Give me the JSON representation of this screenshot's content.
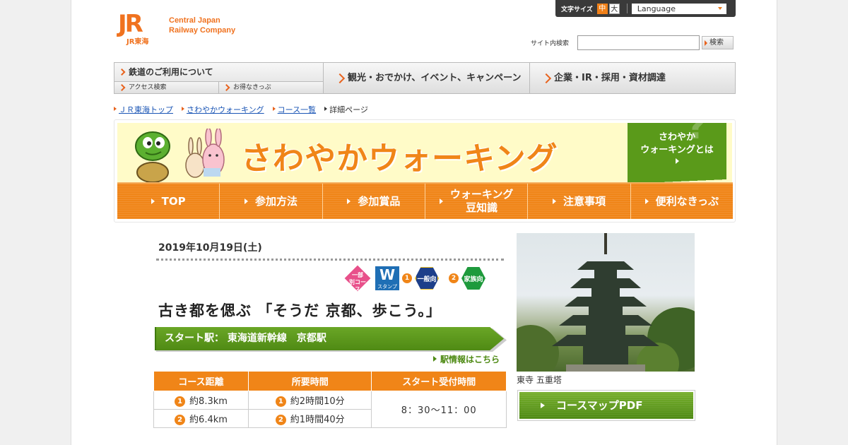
{
  "header": {
    "logo_mark": "JR",
    "logo_sub": "JR東海",
    "logo_line1": "Central Japan",
    "logo_line2": "Railway Company",
    "font_size_label": "文字サイズ",
    "font_size_mid": "中",
    "font_size_large": "大",
    "language_label": "Language",
    "search_label": "サイト内検索",
    "search_value": "",
    "search_button": "検索"
  },
  "gnav": {
    "railway": "鉄道のご利用について",
    "access": "アクセス検索",
    "tickets": "お得なきっぷ",
    "tourism": "観光・おでかけ、イベント、キャンペーン",
    "corporate": "企業・IR・採用・資材調達"
  },
  "breadcrumb": [
    "ＪＲ東海トップ",
    "さわやかウォーキング",
    "コース一覧",
    "詳細ページ"
  ],
  "banner": {
    "title": "さわやかウォーキング",
    "about_line1": "さわやか",
    "about_line2": "ウォーキングとは",
    "nav": [
      "TOP",
      "参加方法",
      "参加賞品",
      "ウォーキング\n豆知識",
      "注意事項",
      "便利なきっぷ"
    ]
  },
  "event": {
    "date": "2019年10月19日(土)",
    "icon_partial": "一部\n別コース",
    "icon_stamp_letter": "W",
    "icon_stamp_label": "スタンプ",
    "icon_num1": "1",
    "icon_general": "一般向",
    "icon_num2": "2",
    "icon_family": "家族向",
    "title": "古き都を偲ぶ 「そうだ 京都、歩こう。」",
    "start_station": "スタート駅： 東海道新幹線　京都駅",
    "station_info_link": "駅情報はこちら"
  },
  "course_table": {
    "headers": [
      "コース距離",
      "所要時間",
      "スタート受付時間"
    ],
    "rows": [
      {
        "num": "1",
        "distance": "約8.3km",
        "duration": "約2時間10分"
      },
      {
        "num": "2",
        "distance": "約6.4km",
        "duration": "約1時間40分"
      }
    ],
    "reception": "8：30～11：00"
  },
  "photo": {
    "caption": "東寺 五重塔"
  },
  "pdf_button": "コースマップPDF",
  "colors": {
    "brand_orange": "#f08518",
    "green": "#5a9a1a",
    "banner_bg": "#fffbc8"
  }
}
